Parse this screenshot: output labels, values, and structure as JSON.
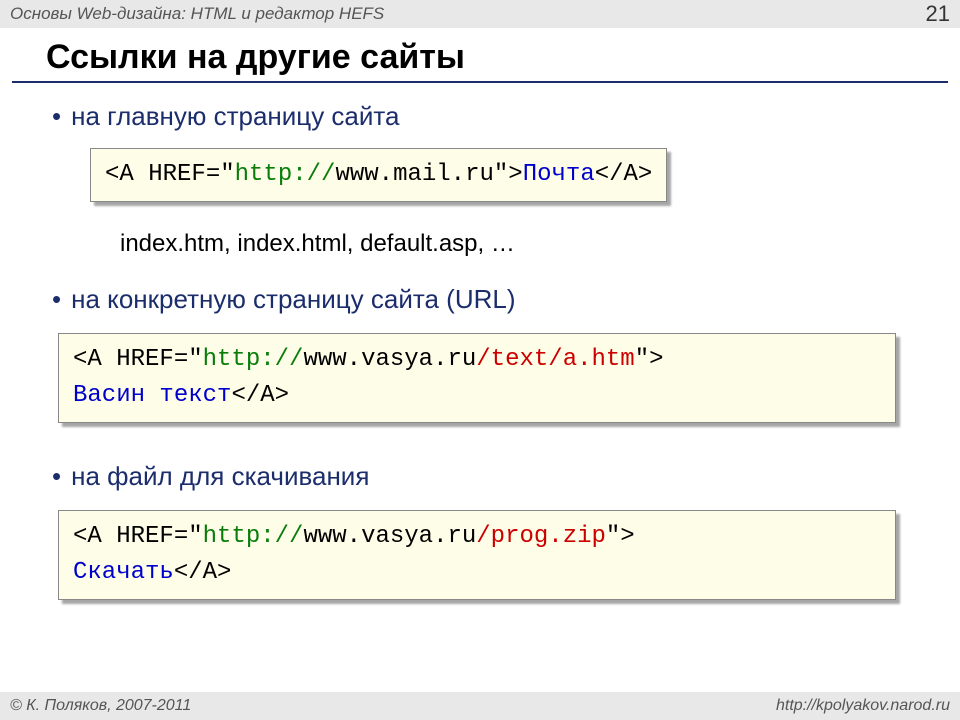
{
  "header": {
    "title": "Основы Web-дизайна: HTML и редактор HEFS",
    "page_number": "21"
  },
  "slide": {
    "title": "Ссылки на другие сайты",
    "section1": {
      "bullet": "на главную страницу сайта",
      "code": {
        "prefix": "<A HREF=\"",
        "protocol": "http://",
        "host": "www.mail.ru",
        "midquote": "\">",
        "linktext": "Почта",
        "close": "</A>"
      },
      "note": "index.htm, index.html, default.asp, …"
    },
    "section2": {
      "bullet": "на конкретную страницу сайта (URL)",
      "code": {
        "prefix": "<A HREF=\"",
        "protocol": "http://",
        "host": "www.vasya.ru",
        "path": "/text/a.htm",
        "midquote": "\">",
        "linktext": "Васин текст",
        "close": "</A>"
      }
    },
    "section3": {
      "bullet": "на файл для скачивания",
      "code": {
        "prefix": "<A HREF=\"",
        "protocol": "http://",
        "host": "www.vasya.ru",
        "path": "/prog.zip",
        "midquote": "\">",
        "linktext": "Скачать",
        "close": "</A>"
      }
    }
  },
  "footer": {
    "copyright": "© К. Поляков, 2007-2011",
    "url": "http://kpolyakov.narod.ru"
  }
}
